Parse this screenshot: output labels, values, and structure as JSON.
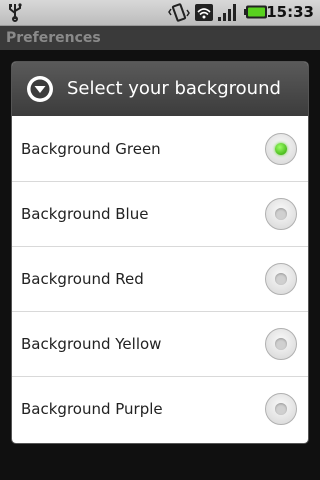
{
  "status_bar": {
    "time": "15:33",
    "icons": [
      "usb-icon",
      "vibrate-icon",
      "wifi-icon",
      "signal-icon",
      "battery-icon"
    ]
  },
  "background_app": {
    "title": "Preferences"
  },
  "dialog": {
    "title": "Select your background",
    "header_icon": "chevron-down-circle-icon",
    "options": [
      {
        "label": "Background Green",
        "checked": true
      },
      {
        "label": "Background Blue",
        "checked": false
      },
      {
        "label": "Background Red",
        "checked": false
      },
      {
        "label": "Background Yellow",
        "checked": false
      },
      {
        "label": "Background Purple",
        "checked": false
      }
    ]
  },
  "colors": {
    "accent_checked": "#2aa100"
  }
}
